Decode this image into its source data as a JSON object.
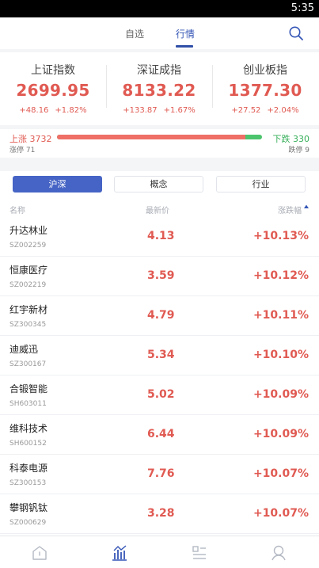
{
  "statusbar": {
    "time": "5:35"
  },
  "topnav": {
    "tabs": [
      "自选",
      "行情"
    ],
    "active_tab": "行情",
    "search_icon": "search-icon",
    "accent_color": "#2f4fa7"
  },
  "indices": [
    {
      "name": "上证指数",
      "value": "2699.95",
      "change": "+48.16",
      "change_pct": "+1.82%"
    },
    {
      "name": "深证成指",
      "value": "8133.22",
      "change": "+133.87",
      "change_pct": "+1.67%"
    },
    {
      "name": "创业板指",
      "value": "1377.30",
      "change": "+27.52",
      "change_pct": "+2.04%"
    }
  ],
  "breadth": {
    "up": "上涨 3732",
    "down": "下跌 330",
    "limit_up": "涨停 71",
    "limit_down": "跌停 9",
    "up_ratio": 0.9188,
    "up_color": "#ef6f67",
    "down_color": "#4cc46d"
  },
  "segments": [
    "沪深",
    "概念",
    "行业"
  ],
  "active_segment": "沪深",
  "table": {
    "headers": {
      "name": "名称",
      "price": "最新价",
      "change": "涨跌幅"
    },
    "sort_icon": "sort-desc-icon",
    "rows": [
      {
        "name": "升达林业",
        "code": "SZ002259",
        "price": "4.13",
        "pct": "+10.13%"
      },
      {
        "name": "恒康医疗",
        "code": "SZ002219",
        "price": "3.59",
        "pct": "+10.12%"
      },
      {
        "name": "红宇新材",
        "code": "SZ300345",
        "price": "4.79",
        "pct": "+10.11%"
      },
      {
        "name": "迪威迅",
        "code": "SZ300167",
        "price": "5.34",
        "pct": "+10.10%"
      },
      {
        "name": "合锻智能",
        "code": "SH603011",
        "price": "5.02",
        "pct": "+10.09%"
      },
      {
        "name": "维科技术",
        "code": "SH600152",
        "price": "6.44",
        "pct": "+10.09%"
      },
      {
        "name": "科泰电源",
        "code": "SZ300153",
        "price": "7.76",
        "pct": "+10.07%"
      },
      {
        "name": "攀钢钒钛",
        "code": "SZ000629",
        "price": "3.28",
        "pct": "+10.07%"
      }
    ]
  },
  "bottomnav": {
    "icons": [
      "home-icon",
      "market-chart-icon",
      "news-list-icon",
      "profile-icon"
    ],
    "active_icon": "market-chart-icon",
    "active_color": "#3556b6",
    "inactive_color": "#b4b9c3"
  }
}
